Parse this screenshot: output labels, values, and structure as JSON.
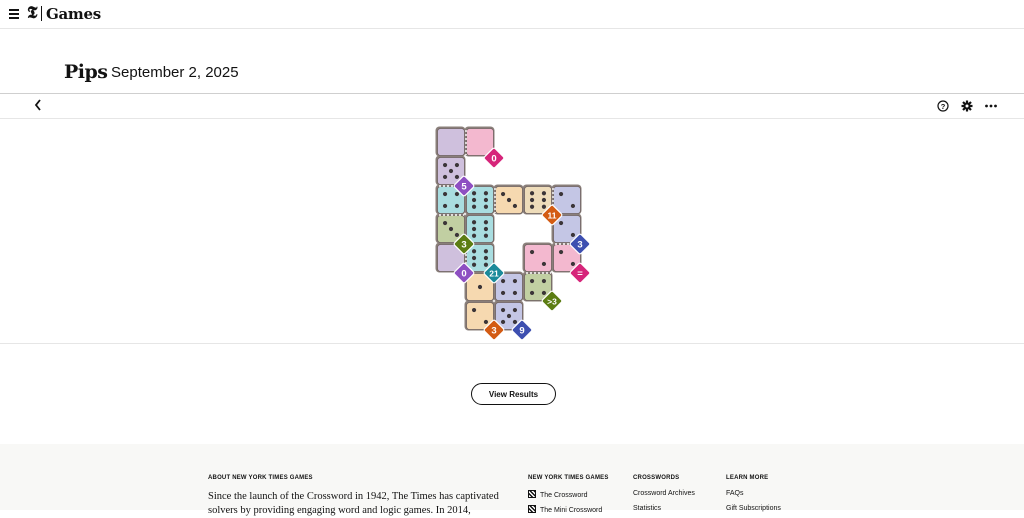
{
  "header": {
    "logo": "𝕿",
    "brand": "Games"
  },
  "page": {
    "title": "Pips",
    "date": "September 2, 2025"
  },
  "toolbar": {
    "back_icon": "chevron-left-icon",
    "help_icon": "help-icon",
    "settings_icon": "gear-icon",
    "more_icon": "more-icon"
  },
  "board": {
    "colors": {
      "purple": "#cfc0dd",
      "pink": "#f3b8cf",
      "teal": "#a9dde0",
      "peach": "#f6d9b0",
      "lavender": "#c4c6e5",
      "olive": "#c1cfa2",
      "gold": "#eedcba"
    },
    "cells": [
      {
        "id": "r0c0",
        "color": "purple",
        "pips": 0
      },
      {
        "id": "r0c1",
        "color": "pink",
        "pips": 0
      },
      {
        "id": "r1c0",
        "color": "purple",
        "pips": 5
      },
      {
        "id": "r2c0",
        "color": "teal",
        "pips": 4
      },
      {
        "id": "r2c1",
        "color": "teal",
        "pips": 6
      },
      {
        "id": "r2c2",
        "color": "peach",
        "pips": 3
      },
      {
        "id": "r2c3",
        "color": "gold",
        "pips": 6
      },
      {
        "id": "r2c4",
        "color": "lavender",
        "pips": 2
      },
      {
        "id": "r3c0",
        "color": "olive",
        "pips": 3
      },
      {
        "id": "r3c1",
        "color": "teal",
        "pips": 6
      },
      {
        "id": "r3c4",
        "color": "lavender",
        "pips": 2
      },
      {
        "id": "r4c0",
        "color": "purple",
        "pips": 0
      },
      {
        "id": "r4c1",
        "color": "teal",
        "pips": 6
      },
      {
        "id": "r4c3",
        "color": "pink",
        "pips": 2
      },
      {
        "id": "r4c4",
        "color": "pink",
        "pips": 2
      },
      {
        "id": "r5c1",
        "color": "peach",
        "pips": 1
      },
      {
        "id": "r5c2",
        "color": "lavender",
        "pips": 4
      },
      {
        "id": "r5c3",
        "color": "olive",
        "pips": 4
      },
      {
        "id": "r6c1",
        "color": "peach",
        "pips": 2
      },
      {
        "id": "r6c2",
        "color": "lavender",
        "pips": 5
      }
    ],
    "badges": [
      {
        "id": "badge-0-pink",
        "label": "0",
        "color": "#d6257a"
      },
      {
        "id": "badge-5",
        "label": "5",
        "color": "#8e4fc2"
      },
      {
        "id": "badge-11",
        "label": "11",
        "color": "#d35b13"
      },
      {
        "id": "badge-3-blue",
        "label": "3",
        "color": "#3d4fb0"
      },
      {
        "id": "badge-3-green",
        "label": "3",
        "color": "#5c7d13"
      },
      {
        "id": "badge-0-purple",
        "label": "0",
        "color": "#8e4fc2"
      },
      {
        "id": "badge-21",
        "label": "21",
        "color": "#1b8a9a"
      },
      {
        "id": "badge-eq",
        "label": "=",
        "color": "#d6257a"
      },
      {
        "id": "badge-gt3",
        "label": ">3",
        "color": "#5c7d13"
      },
      {
        "id": "badge-3-orange",
        "label": "3",
        "color": "#d35b13"
      },
      {
        "id": "badge-9",
        "label": "9",
        "color": "#3d4fb0"
      }
    ]
  },
  "actions": {
    "view_results": "View Results"
  },
  "footer": {
    "about_heading": "ABOUT NEW YORK TIMES GAMES",
    "about_text": "Since the launch of the Crossword in 1942, The Times has captivated solvers by providing engaging word and logic games. In 2014,",
    "col1_heading": "NEW YORK TIMES GAMES",
    "col1_links": [
      "The Crossword",
      "The Mini Crossword"
    ],
    "col2_heading": "CROSSWORDS",
    "col2_links": [
      "Crossword Archives",
      "Statistics"
    ],
    "col3_heading": "LEARN MORE",
    "col3_links": [
      "FAQs",
      "Gift Subscriptions"
    ]
  }
}
